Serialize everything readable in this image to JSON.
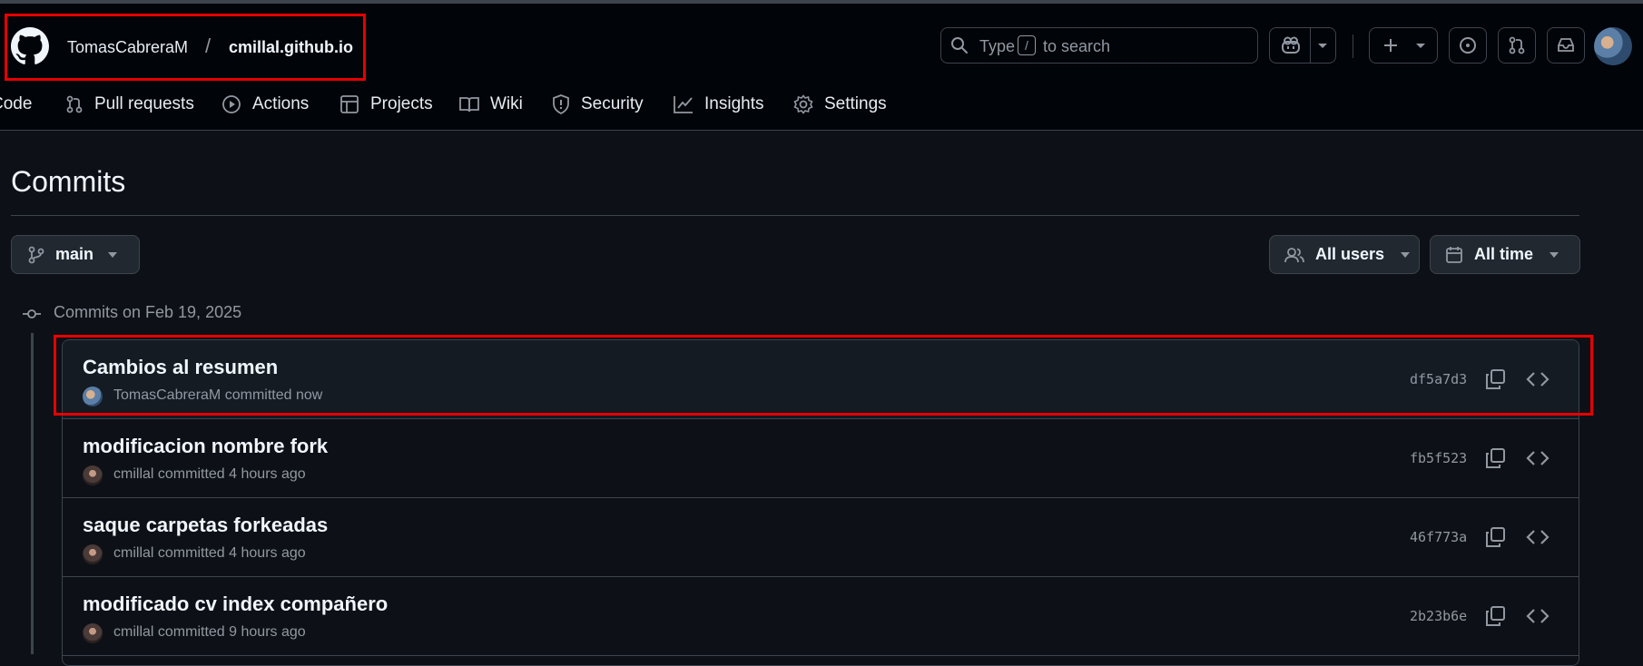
{
  "header": {
    "owner": "TomasCabreraM",
    "separator": "/",
    "repo": "cmillal.github.io",
    "search": {
      "prefix": "Type",
      "key": "/",
      "suffix": "to search"
    }
  },
  "nav": [
    {
      "label": "Code",
      "icon": "code-icon"
    },
    {
      "label": "Pull requests",
      "icon": "pull-request-icon"
    },
    {
      "label": "Actions",
      "icon": "play-icon"
    },
    {
      "label": "Projects",
      "icon": "table-icon"
    },
    {
      "label": "Wiki",
      "icon": "book-icon"
    },
    {
      "label": "Security",
      "icon": "shield-icon"
    },
    {
      "label": "Insights",
      "icon": "graph-icon"
    },
    {
      "label": "Settings",
      "icon": "gear-icon"
    }
  ],
  "page": {
    "title": "Commits",
    "branch": "main",
    "users_filter": "All users",
    "time_filter": "All time"
  },
  "group": {
    "heading": "Commits on Feb 19, 2025",
    "commits": [
      {
        "message": "Cambios al resumen",
        "author": "TomasCabreraM",
        "time": "committed now",
        "sha": "df5a7d3"
      },
      {
        "message": "modificacion nombre fork",
        "author": "cmillal",
        "time": "committed 4 hours ago",
        "sha": "fb5f523"
      },
      {
        "message": "saque carpetas forkeadas",
        "author": "cmillal",
        "time": "committed 4 hours ago",
        "sha": "46f773a"
      },
      {
        "message": "modificado cv index compañero",
        "author": "cmillal",
        "time": "committed 9 hours ago",
        "sha": "2b23b6e"
      }
    ]
  },
  "colors": {
    "header_bg": "#010409",
    "page_bg": "#0d1117",
    "border": "#3d444d",
    "muted": "#9198a1",
    "highlight": "#e60000"
  }
}
